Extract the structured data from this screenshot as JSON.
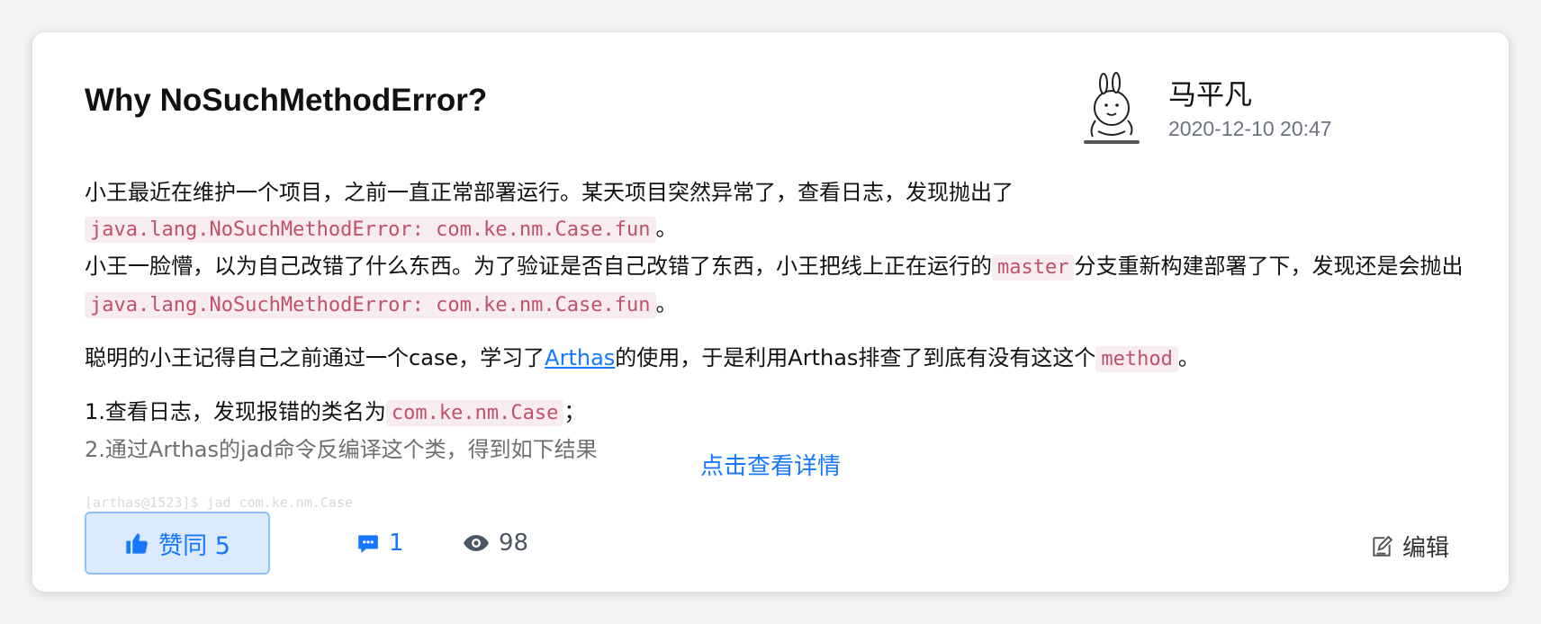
{
  "post": {
    "title": "Why NoSuchMethodError?",
    "author": "马平凡",
    "time": "2020-12-10 20:47",
    "p1_text": "小王最近在维护一个项目，之前一直正常部署运行。某天项目突然异常了，查看日志，发现抛出了",
    "p1_code": "java.lang.NoSuchMethodError: com.ke.nm.Case.fun",
    "p1_end": "。",
    "p2_text_a": "小王一脸懵，以为自己改错了什么东西。为了验证是否自己改错了东西，小王把线上正在运行的",
    "p2_code_master": "master",
    "p2_text_b": "分支重新构建部署了下，发现还是会抛出",
    "p2_code": "java.lang.NoSuchMethodError: com.ke.nm.Case.fun",
    "p2_end": "。",
    "p3_text_a": "聪明的小王记得自己之前通过一个case，学习了",
    "p3_link": "Arthas",
    "p3_text_b": "的使用，于是利用Arthas排查了到底有没有这这个",
    "p3_code": "method",
    "p3_end": "。",
    "p4_line1_text": "1.查看日志，发现报错的类名为",
    "p4_line1_code": "com.ke.nm.Case",
    "p4_line1_end": "；",
    "p4_line2": "2.通过Arthas的jad命令反编译这个类，得到如下结果",
    "hidden_code": "[arthas@1523]$ jad com.ke.nm.Case",
    "more_label": "点击查看详情"
  },
  "footer": {
    "like_label": "赞同 5",
    "comment_count": "1",
    "view_count": "98",
    "edit_label": "编辑"
  },
  "colors": {
    "accent": "#1677ff",
    "code_bg": "#f7ecef",
    "code_text": "#c0516c"
  }
}
